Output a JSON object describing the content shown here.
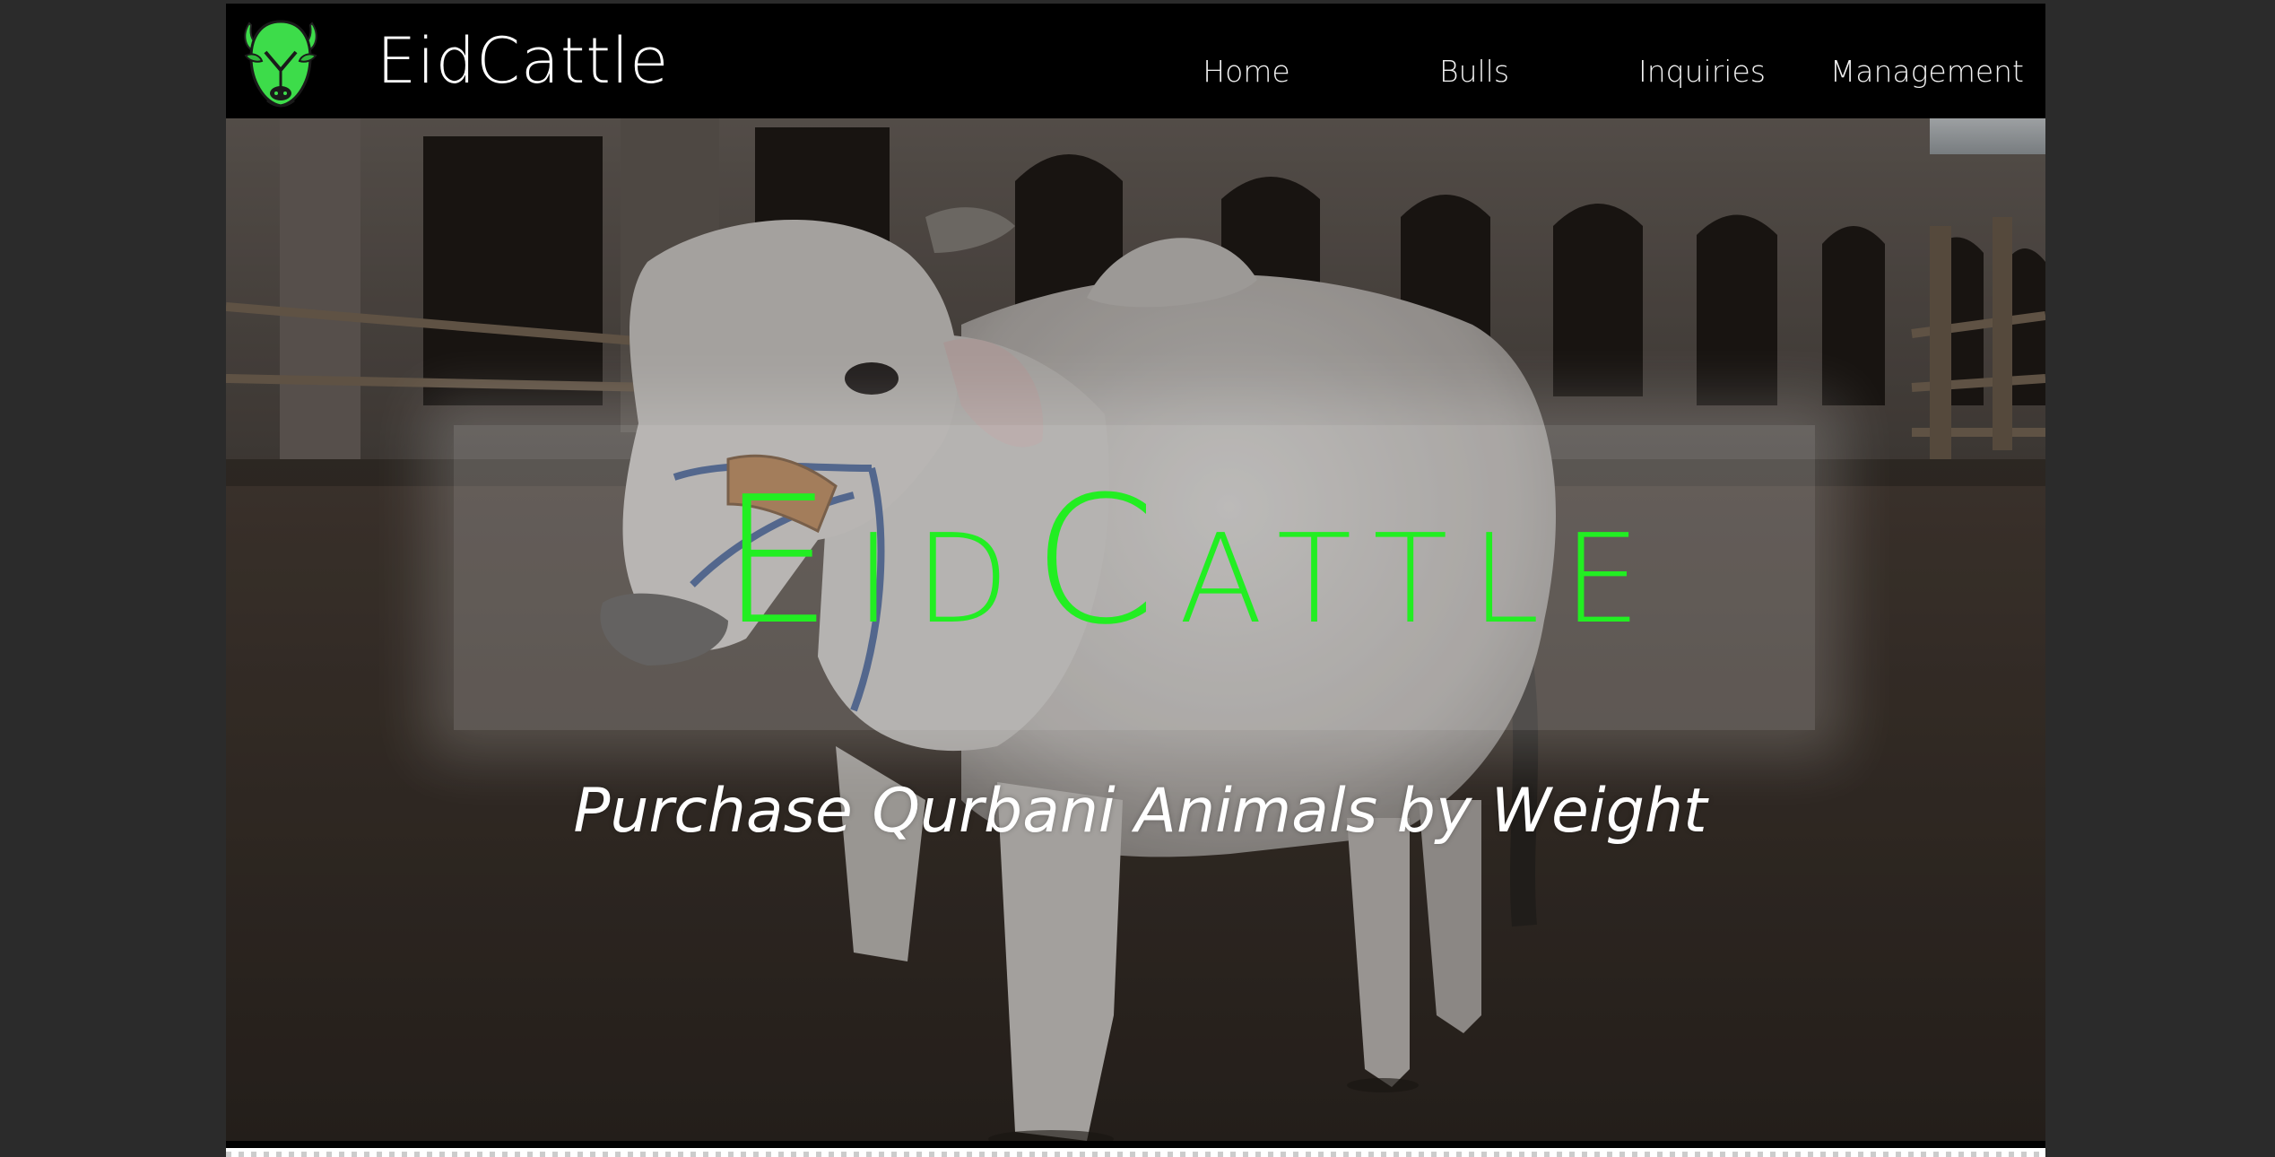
{
  "navbar": {
    "brand": "EidCattle",
    "logo_icon": "bull-head-icon",
    "links": [
      "Home",
      "Bulls",
      "Inquiries",
      "Management"
    ]
  },
  "hero": {
    "title": "EidCattle",
    "subtitle": "Purchase Qurbani Animals by Weight",
    "title_color": "#22ee22",
    "subtitle_color": "#ffffff"
  },
  "colors": {
    "page_bg": "#2b2b2b",
    "navbar_bg": "#000000",
    "accent_green": "#3ddc4a"
  }
}
